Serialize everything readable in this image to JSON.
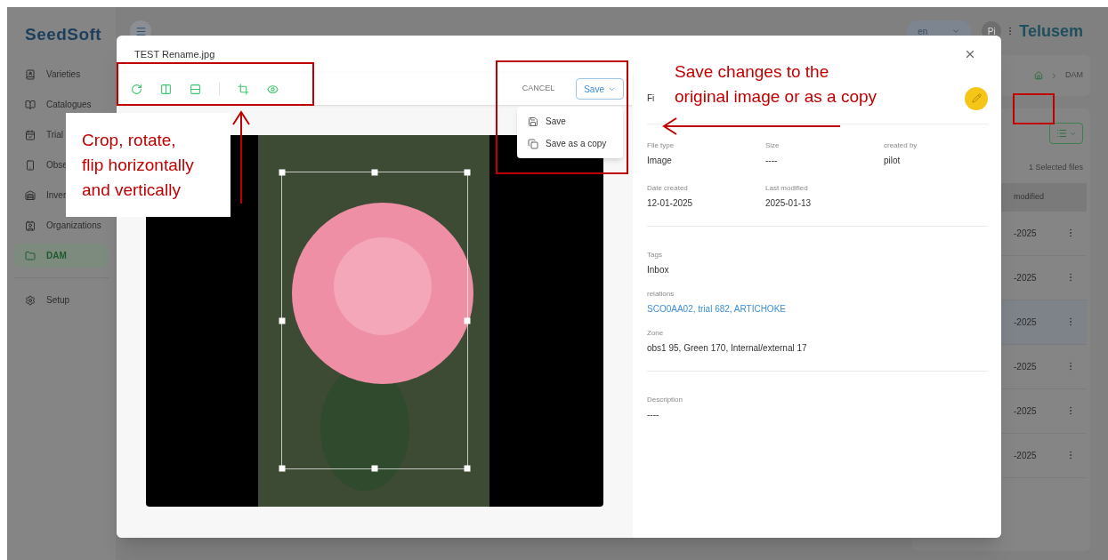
{
  "app": {
    "logo": "SeedSoft",
    "language": "en",
    "avatar": "Pi",
    "brand": "Telusem"
  },
  "sidebar": {
    "items": [
      {
        "label": "Varieties",
        "selected": false
      },
      {
        "label": "Catalogues",
        "selected": false
      },
      {
        "label": "Trial",
        "selected": false
      },
      {
        "label": "Obse",
        "selected": false
      },
      {
        "label": "Inver",
        "selected": false
      },
      {
        "label": "Organizations",
        "selected": false
      },
      {
        "label": "DAM",
        "selected": true
      },
      {
        "label": "Setup",
        "selected": false
      }
    ]
  },
  "background": {
    "breadcrumb": "DAM",
    "selection_count": "1 Selected files",
    "column_header": "modified",
    "rows": [
      "-2025",
      "-2025",
      "-2025",
      "-2025",
      "-2025",
      "-2025"
    ]
  },
  "dialog": {
    "title": "TEST Rename.jpg",
    "tools": [
      {
        "kind": "rotate"
      },
      {
        "kind": "flip_horizontal"
      },
      {
        "kind": "flip_vertical"
      },
      {
        "kind": "separator"
      },
      {
        "kind": "crop"
      },
      {
        "kind": "preview"
      }
    ],
    "cancel": "CANCEL",
    "save": "Save",
    "save_menu": [
      {
        "kind": "save",
        "label": "Save"
      },
      {
        "kind": "copy",
        "label": "Save as a copy"
      }
    ],
    "details": {
      "heading": "Fi",
      "sections": [
        {
          "kind": "grid",
          "fields": [
            {
              "label": "File type",
              "value": "Image"
            },
            {
              "label": "Size",
              "value": "----"
            },
            {
              "label": "created by",
              "value": "pilot"
            }
          ]
        },
        {
          "kind": "grid",
          "fields": [
            {
              "label": "Date created",
              "value": "12-01-2025"
            },
            {
              "label": "Last modified",
              "value": "2025-01-13"
            }
          ]
        },
        {
          "kind": "divider"
        },
        {
          "kind": "stack",
          "fields": [
            {
              "label": "Tags",
              "value": "Inbox"
            },
            {
              "label": "relations",
              "value": "SCO0AA02, trial 682, ARTICHOKE",
              "kind": "link"
            },
            {
              "label": "Zone",
              "value": "obs1 95, Green 170, Internal/external 17"
            }
          ]
        },
        {
          "kind": "divider"
        },
        {
          "kind": "stack",
          "fields": [
            {
              "label": "Description",
              "value": "----"
            }
          ]
        }
      ]
    }
  },
  "annotations": [
    {
      "lines": [
        "Crop, rotate,",
        "flip horizontally",
        "and vertically"
      ]
    },
    {
      "lines": [
        "Save changes to the",
        "original image or as a copy"
      ]
    }
  ]
}
